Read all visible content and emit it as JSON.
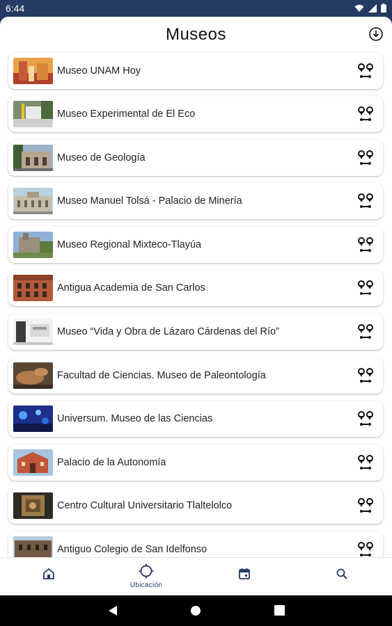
{
  "status_bar": {
    "time": "6:44"
  },
  "header": {
    "title": "Museos"
  },
  "museums": [
    {
      "name": "Museo UNAM Hoy"
    },
    {
      "name": "Museo Experimental de El Eco"
    },
    {
      "name": "Museo de Geología"
    },
    {
      "name": "Museo Manuel Tolsá - Palacio de Minería"
    },
    {
      "name": "Museo Regional Mixteco-Tlayúa"
    },
    {
      "name": "Antigua Academia de San Carlos"
    },
    {
      "name": "Museo “Vida y Obra de Lázaro Cárdenas del Río”"
    },
    {
      "name": "Facultad de Ciencias. Museo de Paleontología"
    },
    {
      "name": "Universum. Museo de las Ciencias"
    },
    {
      "name": "Palacio de la Autonomía"
    },
    {
      "name": "Centro Cultural Universitario Tlaltelolco"
    },
    {
      "name": "Antiguo Colegio de San Idelfonso"
    }
  ],
  "bottom_nav": {
    "items": [
      {
        "icon": "home-icon"
      },
      {
        "icon": "location-icon",
        "label": "Ubicación",
        "active": true
      },
      {
        "icon": "calendar-icon"
      },
      {
        "icon": "search-icon"
      }
    ]
  },
  "colors": {
    "primary": "#243a63",
    "background": "#ffffff",
    "text": "#222222"
  }
}
